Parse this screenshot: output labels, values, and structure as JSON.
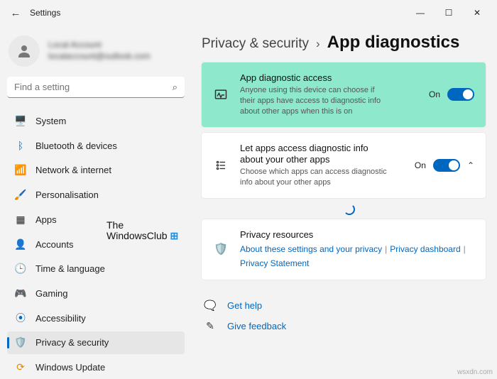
{
  "window": {
    "title": "Settings"
  },
  "user": {
    "name": "Local Account",
    "email": "localaccount@outlook.com"
  },
  "search": {
    "placeholder": "Find a setting"
  },
  "nav": {
    "items": [
      {
        "label": "System"
      },
      {
        "label": "Bluetooth & devices"
      },
      {
        "label": "Network & internet"
      },
      {
        "label": "Personalisation"
      },
      {
        "label": "Apps"
      },
      {
        "label": "Accounts"
      },
      {
        "label": "Time & language"
      },
      {
        "label": "Gaming"
      },
      {
        "label": "Accessibility"
      },
      {
        "label": "Privacy & security"
      },
      {
        "label": "Windows Update"
      }
    ]
  },
  "breadcrumb": {
    "parent": "Privacy & security",
    "sep": "›",
    "current": "App diagnostics"
  },
  "cards": {
    "diag_access": {
      "title": "App diagnostic access",
      "desc": "Anyone using this device can choose if their apps have access to diagnostic info about other apps when this is on",
      "state": "On"
    },
    "let_apps": {
      "title": "Let apps access diagnostic info about your other apps",
      "desc": "Choose which apps can access diagnostic info about your other apps",
      "state": "On"
    },
    "privacy": {
      "title": "Privacy resources",
      "links": [
        "About these settings and your privacy",
        "Privacy dashboard",
        "Privacy Statement"
      ]
    }
  },
  "help": {
    "get_help": "Get help",
    "feedback": "Give feedback"
  },
  "watermark": {
    "line1": "The",
    "line2": "WindowsClub"
  },
  "footer": "wsxdn.com"
}
